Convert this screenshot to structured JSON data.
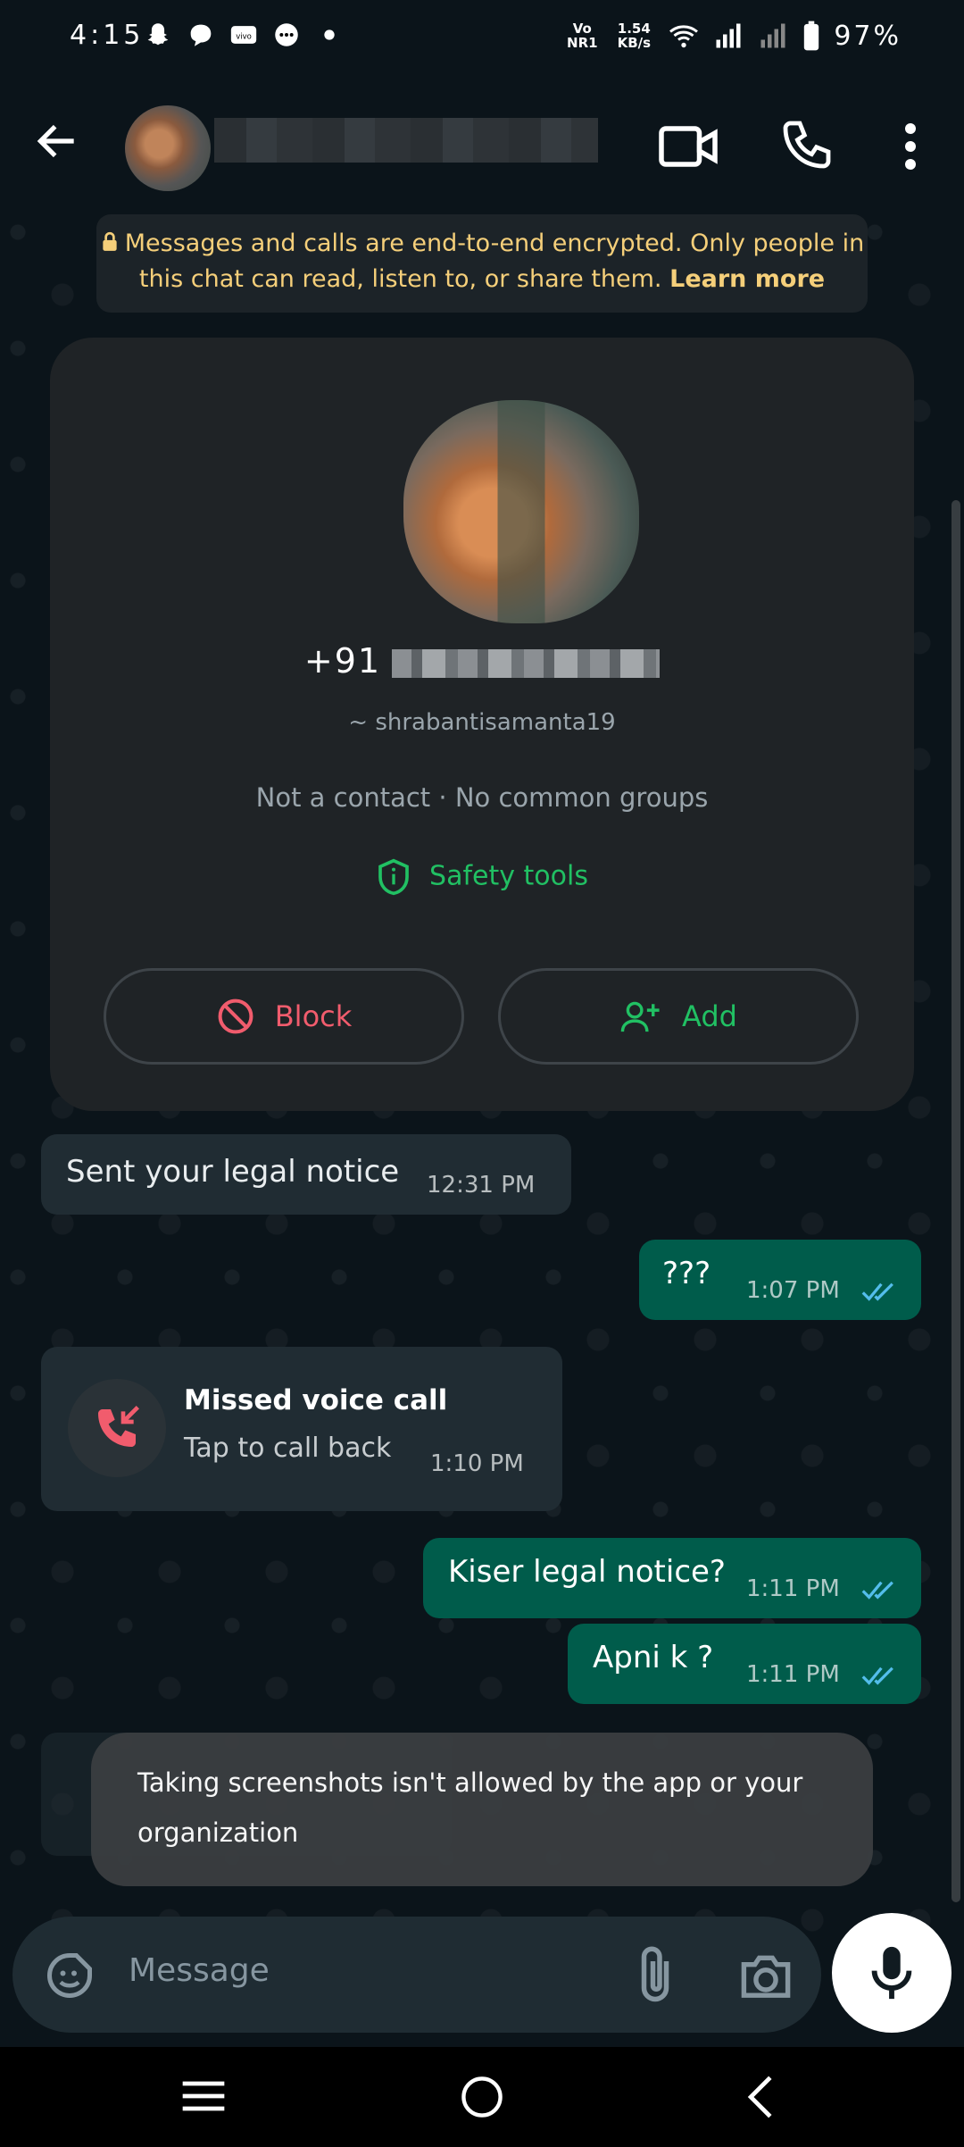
{
  "status_bar": {
    "time": "4:15",
    "net_type": "Vo NR1",
    "speed": "1.54 KB/s",
    "battery": "97%"
  },
  "chat_header": {
    "contact_name": ""
  },
  "encryption_notice": {
    "text": "Messages and calls are end-to-end encrypted. Only people in this chat can read, listen to, or share them.",
    "link": "Learn more"
  },
  "contact_card": {
    "phone_prefix": "+91",
    "handle": "~ shrabantisamanta19",
    "meta": "Not a contact · No common groups",
    "safety_label": "Safety tools",
    "block_label": "Block",
    "add_label": "Add"
  },
  "messages": [
    {
      "direction": "in",
      "text": "Sent your legal notice",
      "time": "12:31 PM"
    },
    {
      "direction": "out",
      "text": "???",
      "time": "1:07 PM",
      "status": "read"
    },
    {
      "direction": "in",
      "type": "missed_call",
      "title": "Missed voice call",
      "subtitle": "Tap to call back",
      "time": "1:10 PM"
    },
    {
      "direction": "out",
      "text": "Kiser legal notice?",
      "time": "1:11 PM",
      "status": "read"
    },
    {
      "direction": "out",
      "text": "Apni k ?",
      "time": "1:11 PM",
      "status": "read"
    }
  ],
  "toast": {
    "text": "Taking screenshots isn't allowed by the app or your organization"
  },
  "composer": {
    "placeholder": "Message"
  },
  "colors": {
    "accent_green": "#21c063",
    "danger_red": "#f15c6d",
    "out_bubble": "#005c4b",
    "in_bubble": "#202c33",
    "read_ticks": "#53bdeb"
  },
  "icons": [
    "back-arrow",
    "video-call",
    "voice-call",
    "more-vertical",
    "lock",
    "shield",
    "block",
    "add-person",
    "missed-call",
    "double-check",
    "sticker",
    "attach",
    "camera",
    "mic",
    "nav-recents",
    "nav-home",
    "nav-back"
  ]
}
